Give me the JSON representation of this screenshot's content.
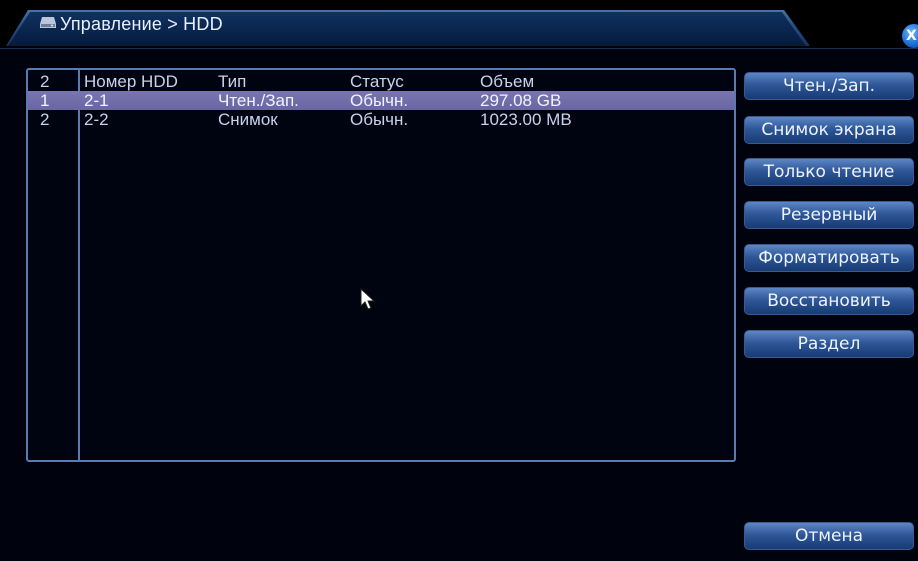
{
  "window": {
    "title": "Управление > HDD",
    "close_label": "X"
  },
  "table": {
    "header": {
      "index": "2",
      "hdd": "Номер HDD",
      "type": "Тип",
      "status": "Статус",
      "size": "Объем"
    },
    "rows": [
      {
        "index": "1",
        "hdd": "2-1",
        "type": "Чтен./Зап.",
        "status": "Обычн.",
        "size": "297.08 GB",
        "selected": true
      },
      {
        "index": "2",
        "hdd": "2-2",
        "type": "Снимок",
        "status": "Обычн.",
        "size": "1023.00 MB",
        "selected": false
      }
    ]
  },
  "buttons": {
    "read_write": "Чтен./Зап.",
    "snapshot": "Снимок экрана",
    "read_only": "Только чтение",
    "backup": "Резервный",
    "format": "Форматировать",
    "restore": "Восстановить",
    "partition": "Раздел",
    "cancel": "Отмена"
  },
  "colors": {
    "accent": "#2f5898",
    "selection": "#7a75b0",
    "border": "#5a7bb0",
    "background": "#00020e"
  },
  "icons": {
    "title_icon": "hdd-icon",
    "close_icon": "close-icon",
    "cursor": "mouse-pointer"
  }
}
